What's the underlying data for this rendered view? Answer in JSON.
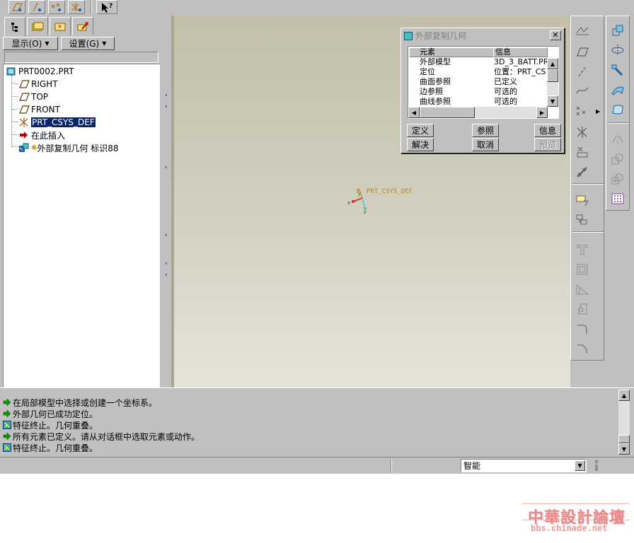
{
  "navigator": {
    "show_menu": "显示(O)",
    "settings_menu": "设置(G)",
    "tree": [
      {
        "label": "PRT0002.PRT",
        "icon": "part-icon"
      },
      {
        "label": "RIGHT",
        "icon": "datum-plane-icon"
      },
      {
        "label": "TOP",
        "icon": "datum-plane-icon"
      },
      {
        "label": "FRONT",
        "icon": "datum-plane-icon"
      },
      {
        "label": "PRT_CSYS_DEF",
        "icon": "coordinate-system-icon",
        "selected": true
      },
      {
        "label": "在此插入",
        "icon": "insert-here-arrow-icon"
      },
      {
        "label": "外部复制几何 标识88",
        "icon": "external-copy-geometry-icon"
      }
    ]
  },
  "graphics": {
    "csys_label": "PRT_CSYS_DEF",
    "axis_x": "x",
    "axis_y": "y",
    "axis_z": "z"
  },
  "dialog": {
    "title": "外部复制几何",
    "col_element": "元素",
    "col_info": "信息",
    "rows": [
      {
        "element": "外部模型",
        "info": "3D_3_BATT.PR"
      },
      {
        "element": "定位",
        "info": "位置：PRT_CS"
      },
      {
        "element": "曲面参照",
        "info": "已定义"
      },
      {
        "element": "边参照",
        "info": "可选的"
      },
      {
        "element": "曲线参照",
        "info": "可选的"
      }
    ],
    "buttons": {
      "define": "定义",
      "refs": "参照",
      "info": "信息",
      "resolve": "解决",
      "cancel": "取消",
      "preview": "预览"
    }
  },
  "messages": [
    {
      "text": "在局部模型中选择或创建一个坐标系。",
      "type": "prompt"
    },
    {
      "text": "外部几何已成功定位。",
      "type": "prompt"
    },
    {
      "text": "特征终止。几何重叠。",
      "type": "warning"
    },
    {
      "text": "所有元素已定义。请从对话框中选取元素或动作。",
      "type": "prompt"
    },
    {
      "text": "特征终止。几何重叠。",
      "type": "warning"
    }
  ],
  "status": {
    "filter_value": "智能"
  },
  "watermark": {
    "main": "中華設計論壇",
    "sub": "bbs.chinade.net"
  },
  "colors": {
    "selection": "#0a246a",
    "prompt_green": "#00a000",
    "csys_orange": "#c08020"
  }
}
